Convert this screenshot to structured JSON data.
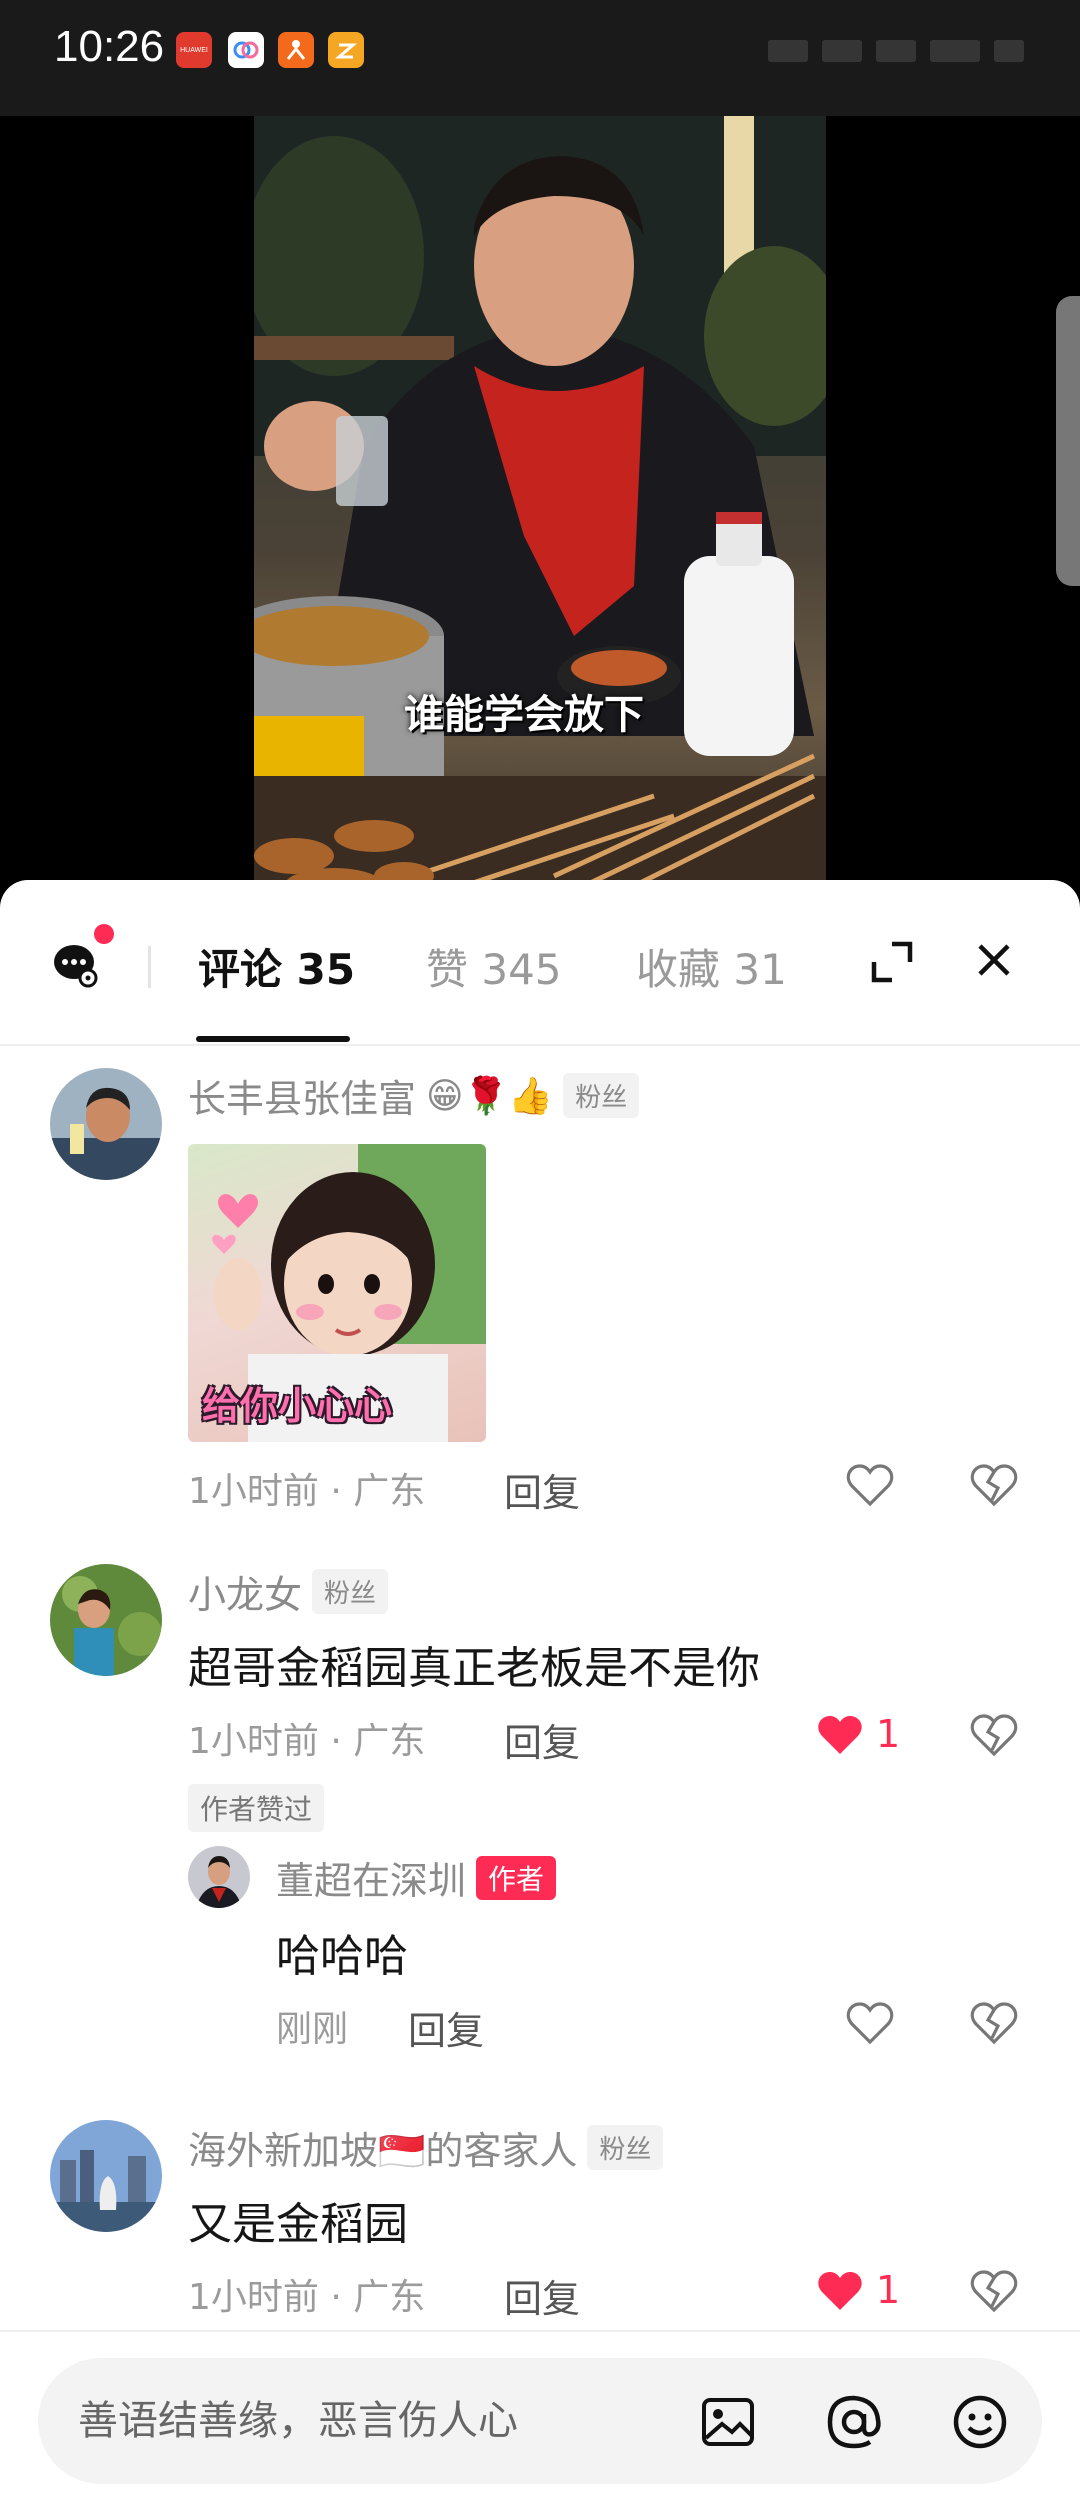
{
  "status_bar": {
    "time": "10:26",
    "apps": [
      {
        "name": "huawei-icon",
        "label": "HUAWEI",
        "color": "#e03a2e"
      },
      {
        "name": "meituan-icon",
        "label": "",
        "color": "#ffffff"
      },
      {
        "name": "kuaishou-icon",
        "label": "",
        "color": "#f36a1c"
      },
      {
        "name": "taobao-icon",
        "label": "",
        "color": "#f5a623"
      }
    ]
  },
  "video": {
    "caption": "谁能学会放下"
  },
  "tabs": {
    "comments": "评论 35",
    "likes": "赞 345",
    "favorites": "收藏 31"
  },
  "comments": [
    {
      "username": "长丰县张佳富",
      "emojis": "😁🌹👍",
      "badge": "粉丝",
      "sticker_text": "给你小心心",
      "meta": "1小时前 · 广东",
      "reply_label": "回复"
    },
    {
      "username": "小龙女",
      "badge": "粉丝",
      "text": "超哥金稻园真正老板是不是你",
      "meta": "1小时前 · 广东",
      "reply_label": "回复",
      "like_count": "1",
      "author_liked": "作者赞过",
      "reply": {
        "username": "董超在深圳",
        "badge": "作者",
        "text": "哈哈哈",
        "meta": "刚刚",
        "reply_label": "回复"
      }
    },
    {
      "username": "海外新加坡🇸🇬的客家人",
      "badge": "粉丝",
      "text": "又是金稻园",
      "meta": "1小时前 · 广东",
      "reply_label": "回复",
      "like_count": "1"
    }
  ],
  "input": {
    "placeholder": "善语结善缘，恶言伤人心"
  },
  "colors": {
    "accent": "#fe2c55",
    "text_primary": "#161616",
    "text_secondary": "#9b9b9b"
  }
}
